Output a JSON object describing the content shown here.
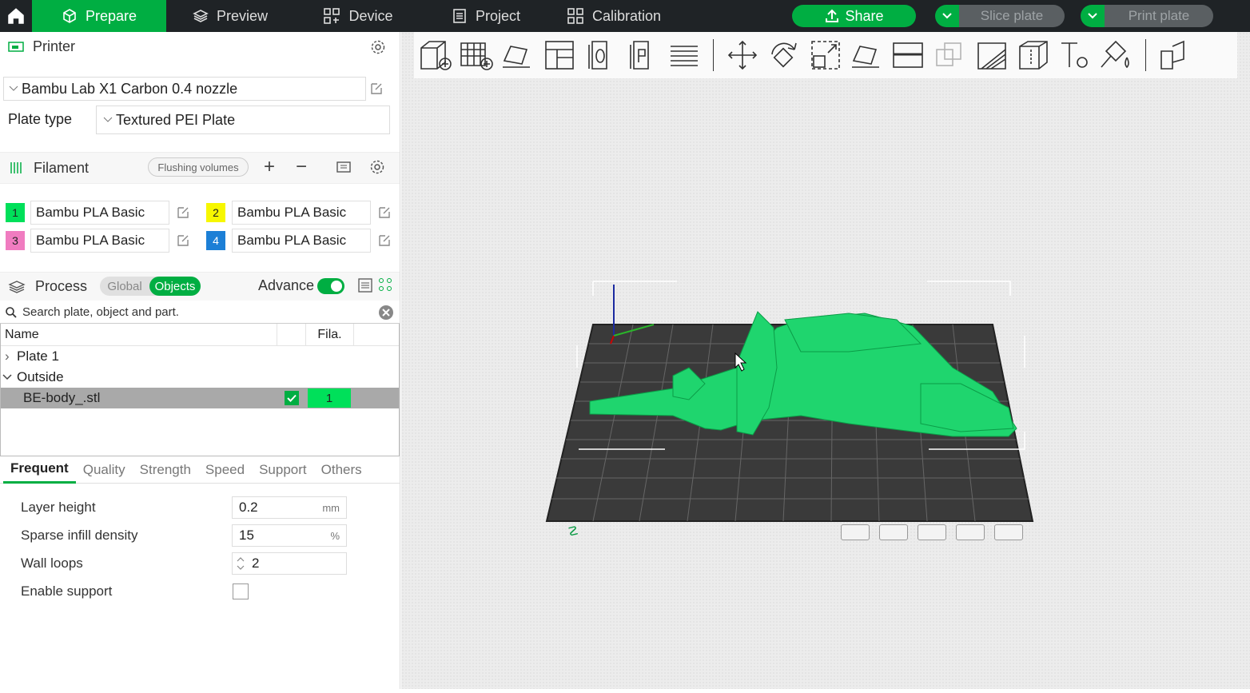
{
  "nav": {
    "tabs": [
      {
        "label": "Prepare",
        "icon": "cube-icon"
      },
      {
        "label": "Preview",
        "icon": "layers-icon"
      },
      {
        "label": "Device",
        "icon": "device-icon"
      },
      {
        "label": "Project",
        "icon": "document-icon"
      },
      {
        "label": "Calibration",
        "icon": "calibration-icon"
      }
    ],
    "share_label": "Share",
    "slice_label": "Slice plate",
    "print_label": "Print plate"
  },
  "printer": {
    "section_label": "Printer",
    "selected": "Bambu Lab X1 Carbon 0.4 nozzle",
    "plate_type_label": "Plate type",
    "plate_type_value": "Textured PEI Plate"
  },
  "filament": {
    "section_label": "Filament",
    "flushing_label": "Flushing volumes",
    "slots": [
      {
        "num": "1",
        "name": "Bambu PLA Basic",
        "color": "#00e05a"
      },
      {
        "num": "2",
        "name": "Bambu PLA Basic",
        "color": "#f7f700"
      },
      {
        "num": "3",
        "name": "Bambu PLA Basic",
        "color": "#f07cc0"
      },
      {
        "num": "4",
        "name": "Bambu PLA Basic",
        "color": "#1c7fd6"
      }
    ]
  },
  "process": {
    "section_label": "Process",
    "global_label": "Global",
    "objects_label": "Objects",
    "advance_label": "Advance",
    "search_placeholder": "Search plate, object and part.",
    "col_name": "Name",
    "col_fila": "Fila.",
    "tree": {
      "plate": "Plate 1",
      "group": "Outside",
      "object": "BE-body_.stl",
      "object_fila": "1"
    },
    "tabs": [
      "Frequent",
      "Quality",
      "Strength",
      "Speed",
      "Support",
      "Others"
    ],
    "params": {
      "layer_height_label": "Layer height",
      "layer_height_value": "0.2",
      "layer_height_unit": "mm",
      "infill_label": "Sparse infill density",
      "infill_value": "15",
      "infill_unit": "%",
      "walls_label": "Wall loops",
      "walls_value": "2",
      "support_label": "Enable support"
    }
  },
  "colors": {
    "accent": "#00ae42",
    "topbar": "#1f2326",
    "model": "#1fd56e"
  }
}
